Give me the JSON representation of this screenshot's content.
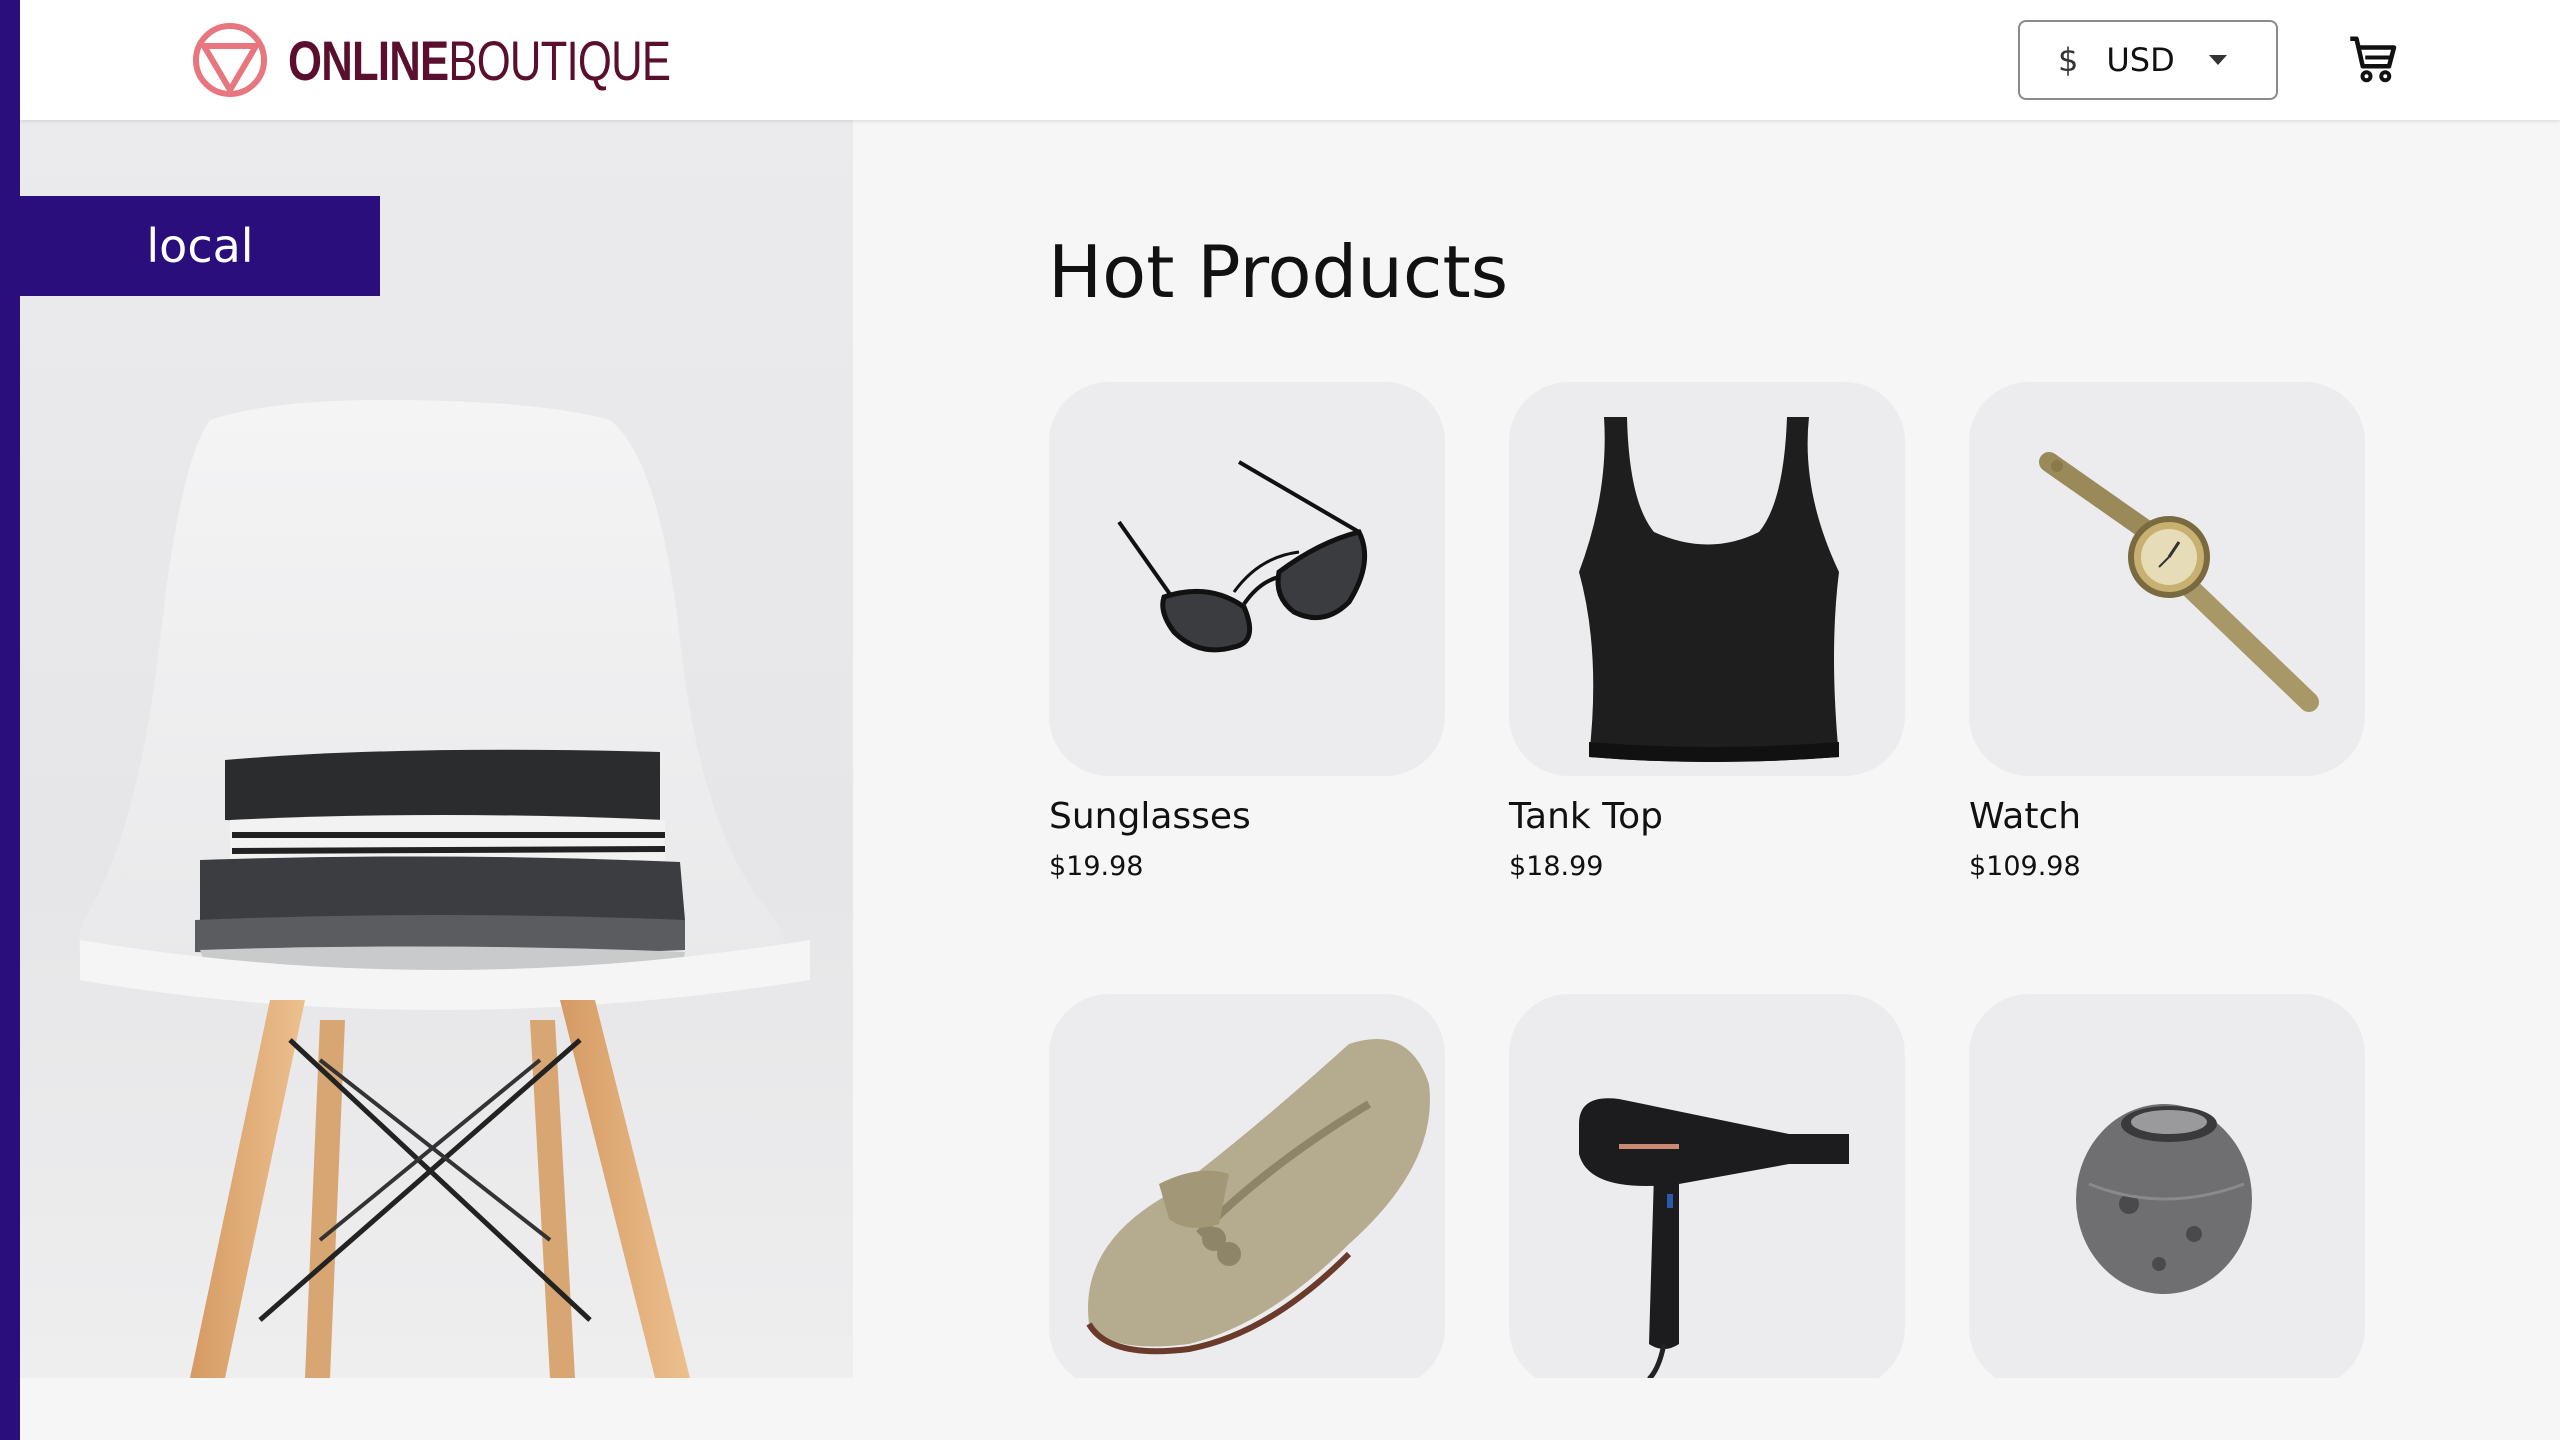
{
  "header": {
    "logo_bold": "ONLINE",
    "logo_light": "BOUTIQUE",
    "currency_symbol": "$",
    "currency_code": "USD"
  },
  "hero": {
    "badge": "local"
  },
  "main": {
    "title": "Hot Products",
    "products": [
      {
        "name": "Sunglasses",
        "price": "$19.98",
        "icon": "sunglasses-image"
      },
      {
        "name": "Tank Top",
        "price": "$18.99",
        "icon": "tank-top-image"
      },
      {
        "name": "Watch",
        "price": "$109.98",
        "icon": "watch-image"
      },
      {
        "name": "",
        "price": "",
        "icon": "loafers-image"
      },
      {
        "name": "",
        "price": "",
        "icon": "hairdryer-image"
      },
      {
        "name": "",
        "price": "",
        "icon": "candle-holder-image"
      }
    ]
  },
  "colors": {
    "accent": "#2a0f7c",
    "logo": "#5a0f2e",
    "logo_icon": "#e8767e"
  }
}
